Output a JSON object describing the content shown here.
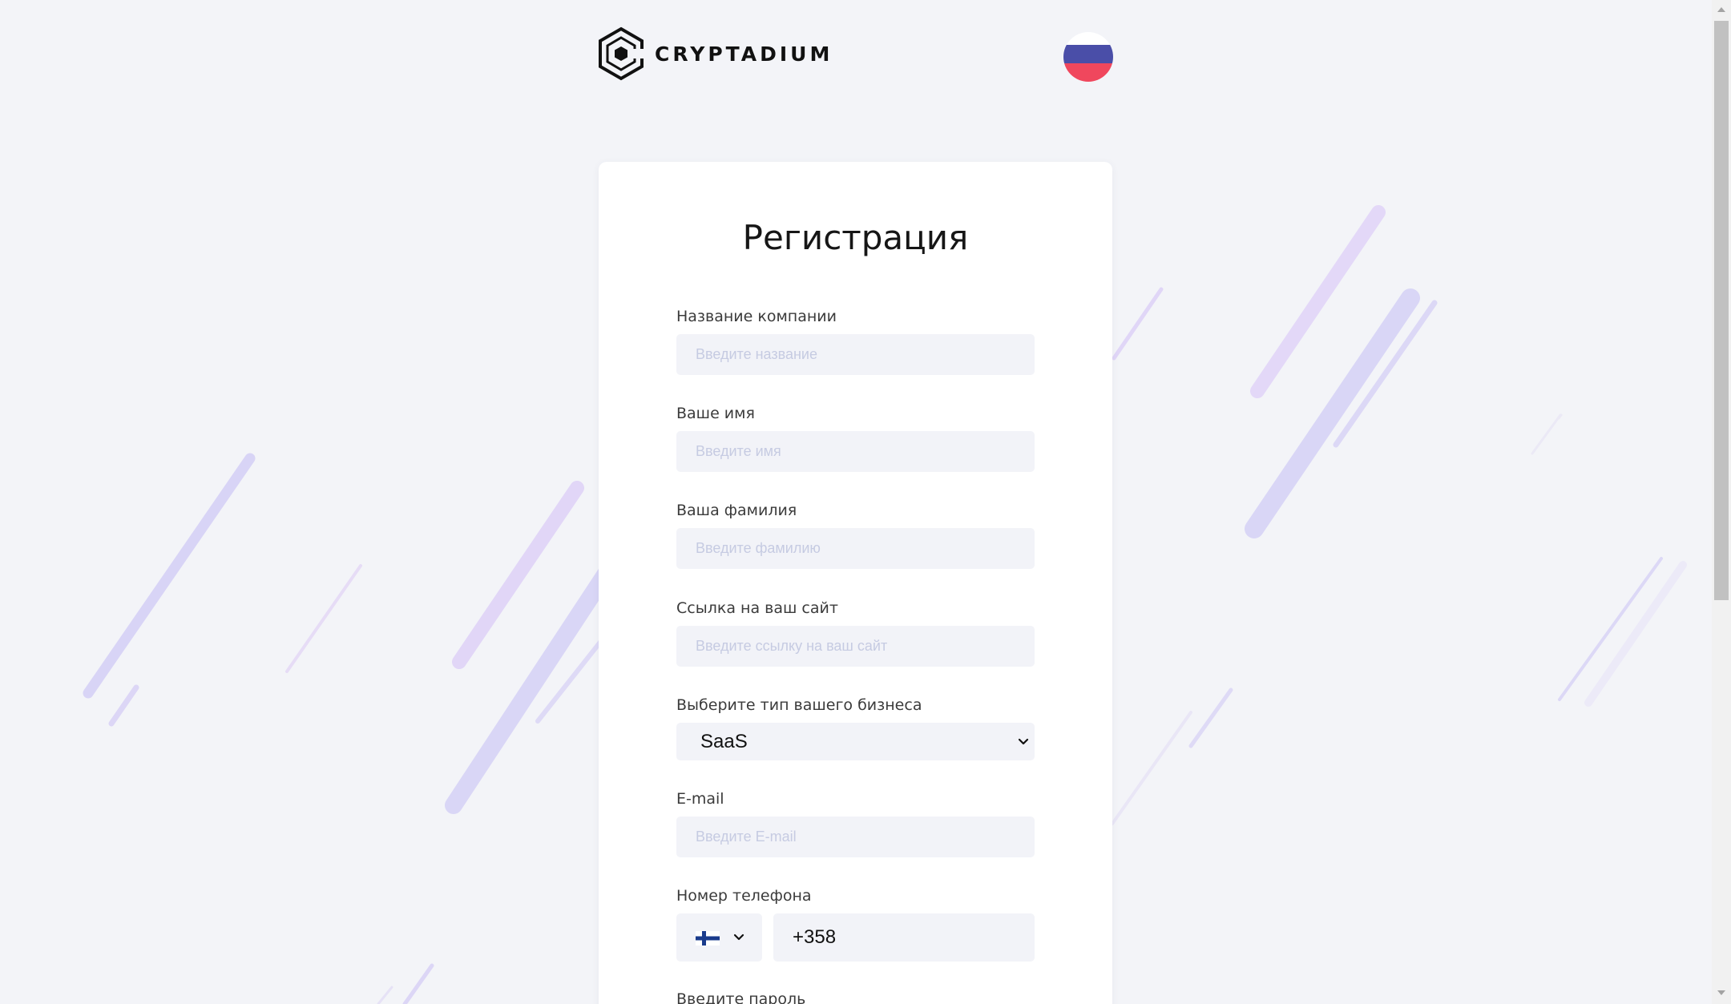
{
  "header": {
    "brand": "CRYPTADIUM",
    "logo_icon": "cryptadium-hexagon-logo",
    "language_flag": "ru",
    "language_flag_colors": [
      "#ffffff",
      "#4a4ea8",
      "#f0475d"
    ]
  },
  "form": {
    "title": "Регистрация",
    "company": {
      "label": "Название компании",
      "placeholder": "Введите название",
      "value": ""
    },
    "first_name": {
      "label": "Ваше имя",
      "placeholder": "Введите имя",
      "value": ""
    },
    "last_name": {
      "label": "Ваша фамилия",
      "placeholder": "Введите фамилию",
      "value": ""
    },
    "website": {
      "label": "Ссылка на ваш сайт",
      "placeholder": "Введите ссылку на ваш сайт",
      "value": ""
    },
    "business_type": {
      "label": "Выберите тип вашего бизнеса",
      "selected": "SaaS"
    },
    "email": {
      "label": "E-mail",
      "placeholder": "Введите E-mail",
      "value": ""
    },
    "phone": {
      "label": "Номер телефона",
      "country_flag": "fi",
      "value": "+358"
    },
    "password": {
      "label": "Введите пароль"
    }
  },
  "colors": {
    "background": "#f3f4f8",
    "input_background": "#f2f3f8",
    "placeholder": "#c6cbe2",
    "streak_purple": "#ddd2f7",
    "streak_blue": "#d6d4f5"
  }
}
